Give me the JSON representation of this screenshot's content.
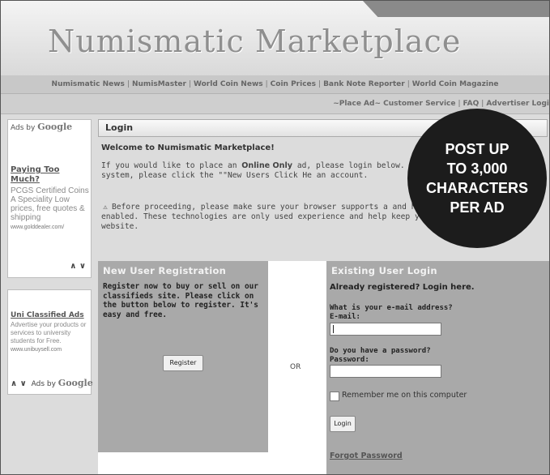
{
  "site": {
    "title": "Numismatic Marketplace"
  },
  "nav": {
    "links": [
      "Numismatic News",
      "NumisMaster",
      "World Coin News",
      "Coin Prices",
      "Bank Note Reporter",
      "World Coin Magazine"
    ]
  },
  "utility": {
    "place_ad": "~Place Ad~",
    "links": [
      "Customer Service",
      "FAQ",
      "Advertiser Logi"
    ]
  },
  "sidebar": {
    "ad1": {
      "ads_by": "Ads by",
      "ads_brand": "Google",
      "title": "Paying Too Much?",
      "description": "PCGS Certified Coins A Speciality Low prices, free quotes & shipping",
      "url": "www.golddealer.com/",
      "arrows": "∧ ∨"
    },
    "ad2": {
      "title": "Uni Classified Ads",
      "description": "Advertise your products or services to university students for Free.",
      "url": "www.unibuysell.com",
      "arrows": "∧ ∨",
      "ads_by": "Ads by",
      "ads_brand": "Google"
    }
  },
  "main": {
    "header": "Login",
    "welcome": "Welcome to Numismatic Marketplace!",
    "intro_before": "If you would like to place an ",
    "intro_bold": "Online Only",
    "intro_after": " ad, please login below. an account on our system, please click the \"\"New Users Click He an account.",
    "notice": "Before proceeding, please make sure your browser supports a and has the JavaScript enabled. These technologies are only used experience and help keep you connected to our website.",
    "promo_lines": [
      "POST UP",
      "TO 3,000",
      "CHARACTERS",
      "PER AD"
    ],
    "new_user": {
      "heading": "New User Registration",
      "description": "Register now to buy or sell on our classifieds site. Please click on the button below to register. It's easy and free.",
      "button": "Register"
    },
    "or_label": "OR",
    "existing": {
      "heading": "Existing User Login",
      "already": "Already registered? Login here.",
      "email_question": "What is your e-mail address?",
      "email_label": "E-mail:",
      "email_value": "",
      "password_question": "Do you have a password?",
      "password_label": "Password:",
      "password_value": "",
      "remember": "Remember me on this computer",
      "remember_checked": false,
      "login_button": "Login",
      "forgot": "Forgot Password"
    }
  }
}
